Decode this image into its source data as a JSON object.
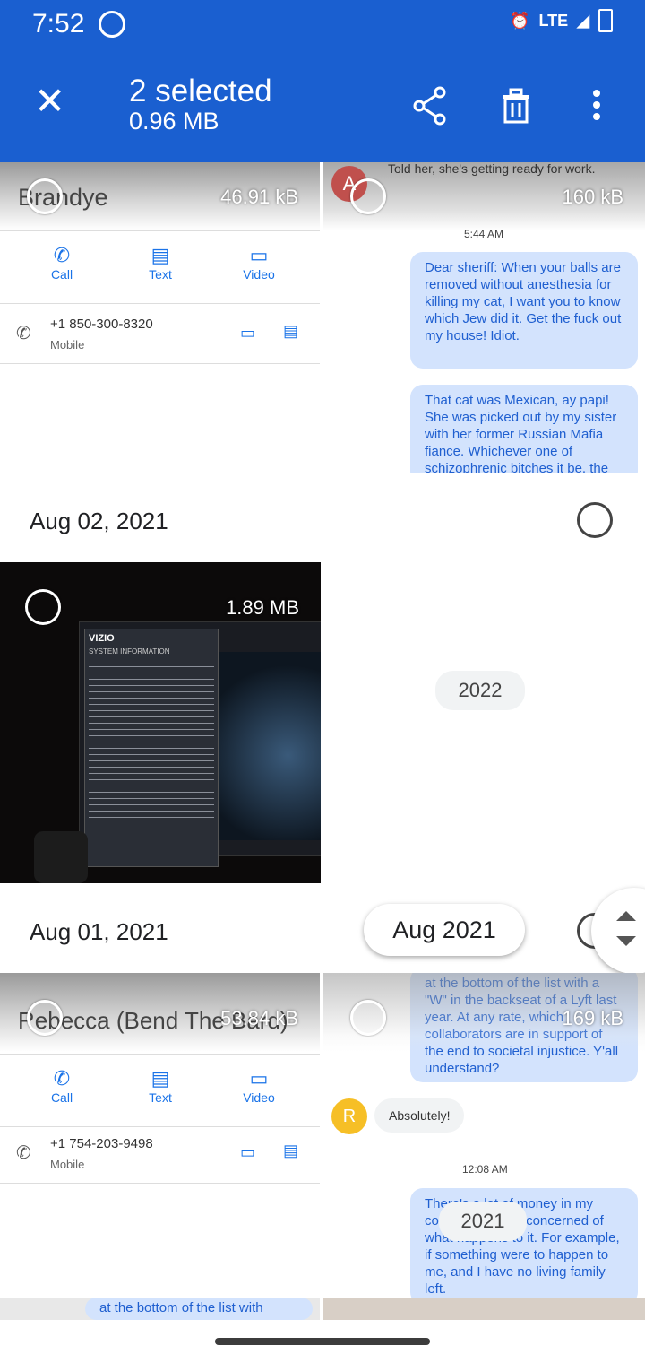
{
  "status": {
    "time": "7:52",
    "network": "LTE"
  },
  "appbar": {
    "title": "2 selected",
    "subtitle": "0.96 MB"
  },
  "tiles": {
    "brandye": {
      "name": "Brandye",
      "size": "46.91 kB",
      "call": "Call",
      "text": "Text",
      "video": "Video",
      "number": "+1 850-300-8320",
      "type": "Mobile"
    },
    "chat1": {
      "size": "160 kB",
      "snippet": "Told her, she's getting ready for work.",
      "time": "5:44 AM",
      "msg1": "Dear sheriff: When your balls are removed without anesthesia for killing my cat, I want you to know which Jew did it. Get the fuck out my house! Idiot.",
      "msg2": "That cat was Mexican, ay papi! She was picked out by my sister with her former Russian Mafia fiance. Whichever one of schizophrenic bitches it be, the"
    },
    "photo": {
      "size": "1.89 MB",
      "brand": "VIZIO",
      "menu": "SYSTEM INFORMATION"
    },
    "rebecca": {
      "name": "Rebecca (Bend The Bard)",
      "size": "53.84 kB",
      "call": "Call",
      "text": "Text",
      "video": "Video",
      "number": "+1 754-203-9498",
      "type": "Mobile"
    },
    "chat2": {
      "size": "169 kB",
      "msg1": "at the bottom of the list with a \"W\" in the backseat of a Lyft last year. At any rate, which collaborators are in support of the end to societal injustice. Y'all understand?",
      "reply": "Absolutely!",
      "avatar": "R",
      "time": "12:08 AM",
      "msg2": "There's a lot of money in my collectively. I am concerned of what happens to it. For example, if something were to happen to me, and I have no living family left."
    },
    "bottom": {
      "snippet": "at the bottom of the list with"
    }
  },
  "headers": {
    "aug02": "Aug 02, 2021",
    "aug01": "Aug 01, 2021"
  },
  "pills": {
    "year2022": "2022",
    "year2021": "2021"
  },
  "scrubber": {
    "label": "Aug 2021"
  }
}
